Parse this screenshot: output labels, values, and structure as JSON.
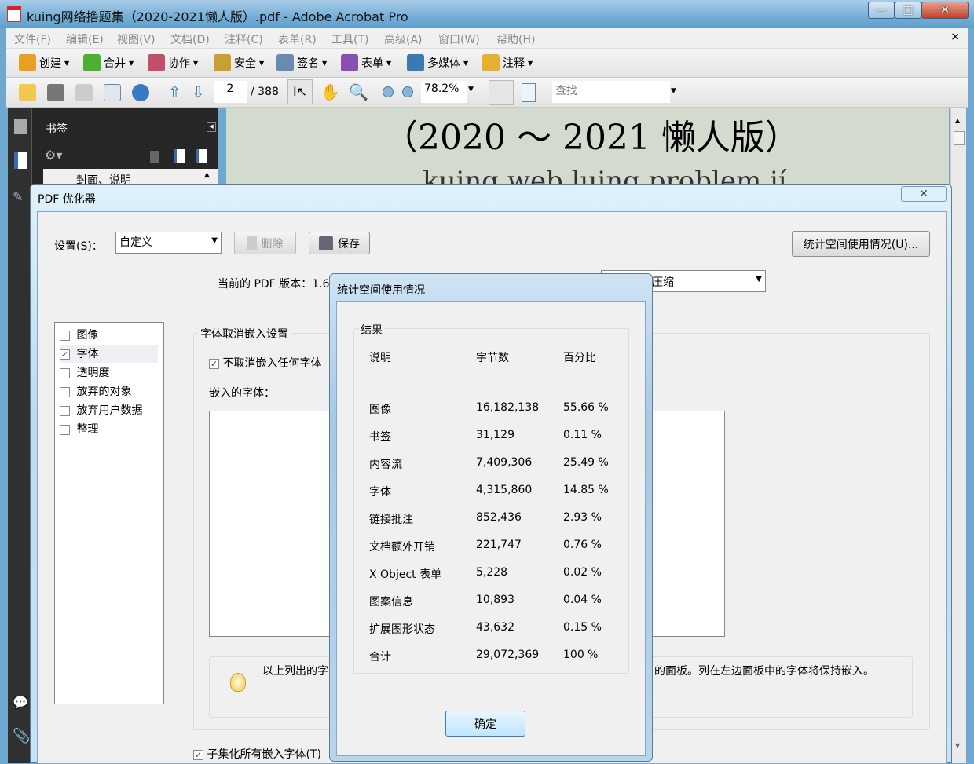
{
  "window": {
    "title": "kuing网络撸题集（2020-2021懒人版）.pdf - Adobe Acrobat Pro",
    "minimize": "—",
    "maximize": "□",
    "close": "✕"
  },
  "menu": [
    "文件(F)",
    "编辑(E)",
    "视图(V)",
    "文档(D)",
    "注释(C)",
    "表单(R)",
    "工具(T)",
    "高级(A)",
    "窗口(W)",
    "帮助(H)"
  ],
  "menu_close": "×",
  "toolbar1": [
    {
      "label": "创建",
      "icon": "create-icon",
      "color": "#e8a020"
    },
    {
      "label": "合并",
      "icon": "combine-icon",
      "color": "#4caf30"
    },
    {
      "label": "协作",
      "icon": "collaborate-icon",
      "color": "#c0506a"
    },
    {
      "label": "安全",
      "icon": "lock-icon",
      "color": "#c8a030"
    },
    {
      "label": "签名",
      "icon": "pen-icon",
      "color": "#6a8ab0"
    },
    {
      "label": "表单",
      "icon": "form-icon",
      "color": "#8a50b0"
    },
    {
      "label": "多媒体",
      "icon": "multimedia-icon",
      "color": "#3a7ab0"
    },
    {
      "label": "注释",
      "icon": "comment-icon",
      "color": "#e8b030"
    }
  ],
  "toolbar2": {
    "page": "2",
    "page_total": "/ 388",
    "zoom": "78.2%",
    "find_placeholder": "查找"
  },
  "bookmarks": {
    "title": "书签",
    "item": "封面、说明"
  },
  "document": {
    "heading": "（2020 ～ 2021 懒人版）",
    "subtitle": "kuing web luing problem jí"
  },
  "optimizer": {
    "title": "PDF 优化器",
    "settings_label": "设置(S)：",
    "settings_value": "自定义",
    "delete": "删除",
    "save": "保存",
    "audit": "统计空间使用情况(U)...",
    "version_label": "当前的 PDF 版本：1.6",
    "compat_value": "压缩",
    "panels": [
      {
        "label": "图像",
        "checked": false
      },
      {
        "label": "字体",
        "checked": true
      },
      {
        "label": "透明度",
        "checked": false
      },
      {
        "label": "放弃的对象",
        "checked": false
      },
      {
        "label": "放弃用户数据",
        "checked": false
      },
      {
        "label": "整理",
        "checked": false
      }
    ],
    "font_group": "字体取消嵌入设置",
    "no_unembed": "不取消嵌入任何字体",
    "embedded_label": "嵌入的字体：",
    "hint_left": "以上列出的字",
    "hint_right": "的面板。列在左边面板中的字体将保持嵌入。",
    "subset": "子集化所有嵌入字体(T)"
  },
  "stats": {
    "title": "统计空间使用情况",
    "group": "结果",
    "headers": [
      "说明",
      "字节数",
      "百分比"
    ],
    "rows": [
      [
        "图像",
        "16,182,138",
        "55.66 %"
      ],
      [
        "书签",
        "31,129",
        "0.11 %"
      ],
      [
        "内容流",
        "7,409,306",
        "25.49 %"
      ],
      [
        "字体",
        "4,315,860",
        "14.85 %"
      ],
      [
        "链接批注",
        "852,436",
        "2.93 %"
      ],
      [
        "文档额外开销",
        "221,747",
        "0.76 %"
      ],
      [
        "X Object 表单",
        "5,228",
        "0.02 %"
      ],
      [
        "图案信息",
        "10,893",
        "0.04 %"
      ],
      [
        "扩展图形状态",
        "43,632",
        "0.15 %"
      ],
      [
        "合计",
        "29,072,369",
        "100 %"
      ]
    ],
    "ok": "确定"
  }
}
